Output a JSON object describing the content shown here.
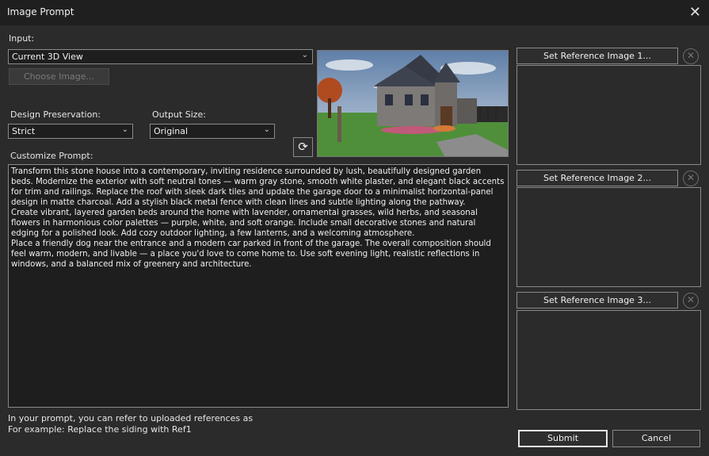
{
  "window": {
    "title": "Image Prompt",
    "close_glyph": "✕"
  },
  "input": {
    "label": "Input:",
    "selected": "Current 3D View",
    "choose_image_label": "Choose Image..."
  },
  "design_preservation": {
    "label": "Design Preservation:",
    "selected": "Strict"
  },
  "output_size": {
    "label": "Output Size:",
    "selected": "Original"
  },
  "refresh_glyph": "⟳",
  "customize_prompt": {
    "label": "Customize Prompt:",
    "text": "Transform this stone house into a contemporary, inviting residence surrounded by lush, beautifully designed garden\nbeds. Modernize the exterior with soft neutral tones — warm gray stone, smooth white plaster, and elegant black accents\nfor trim and railings. Replace the roof with sleek dark tiles and update the garage door to a minimalist horizontal-panel\ndesign in matte charcoal. Add a stylish black metal fence with clean lines and subtle lighting along the pathway.\nCreate vibrant, layered garden beds around the home with lavender, ornamental grasses, wild herbs, and seasonal\nflowers in harmonious color palettes — purple, white, and soft orange. Include small decorative stones and natural\nedging for a polished look. Add cozy outdoor lighting, a few lanterns, and a welcoming atmosphere.\nPlace a friendly dog near the entrance and a modern car parked in front of the garage. The overall composition should\nfeel warm, modern, and livable — a place you'd love to come home to. Use soft evening light, realistic reflections in\nwindows, and a balanced mix of greenery and architecture."
  },
  "hint": {
    "line1": "In your prompt, you can refer to uploaded references as",
    "line2": "For example: Replace the siding with Ref1"
  },
  "references": [
    {
      "button_label": "Set Reference Image 1..."
    },
    {
      "button_label": "Set Reference Image 2..."
    },
    {
      "button_label": "Set Reference Image 3..."
    }
  ],
  "clear_glyph": "✕",
  "chevron_glyph": "⌄",
  "buttons": {
    "submit": "Submit",
    "cancel": "Cancel"
  },
  "colors": {
    "background": "#2b2b2b",
    "field": "#1e1e1e",
    "border": "#8a8a8a"
  }
}
